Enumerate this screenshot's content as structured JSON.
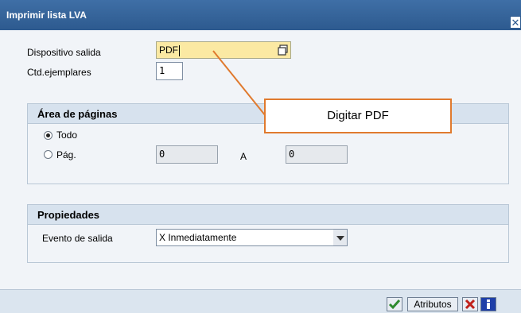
{
  "window": {
    "title": "Imprimir lista LVA"
  },
  "form": {
    "output_device_label": "Dispositivo salida",
    "output_device_value": "PDF",
    "copies_label": "Ctd.ejemplares",
    "copies_value": "1"
  },
  "page_area": {
    "title": "Área de páginas",
    "options": [
      {
        "label": "Todo",
        "selected": true
      },
      {
        "label": "Pág.",
        "selected": false
      }
    ],
    "from_value": "0",
    "to_label": "A",
    "to_value": "0"
  },
  "properties": {
    "title": "Propiedades",
    "output_event_label": "Evento de salida",
    "output_event_value": "X Inmediatamente"
  },
  "annotation": {
    "text": "Digitar PDF",
    "color": "#e07a2e"
  },
  "footer": {
    "attributes_label": "Atributos"
  },
  "colors": {
    "titlebar": "#2d5a8f",
    "highlight_field": "#fbe9a3",
    "confirm": "#2e8b2e",
    "cancel": "#c0221c",
    "info": "#1f3fa8"
  }
}
